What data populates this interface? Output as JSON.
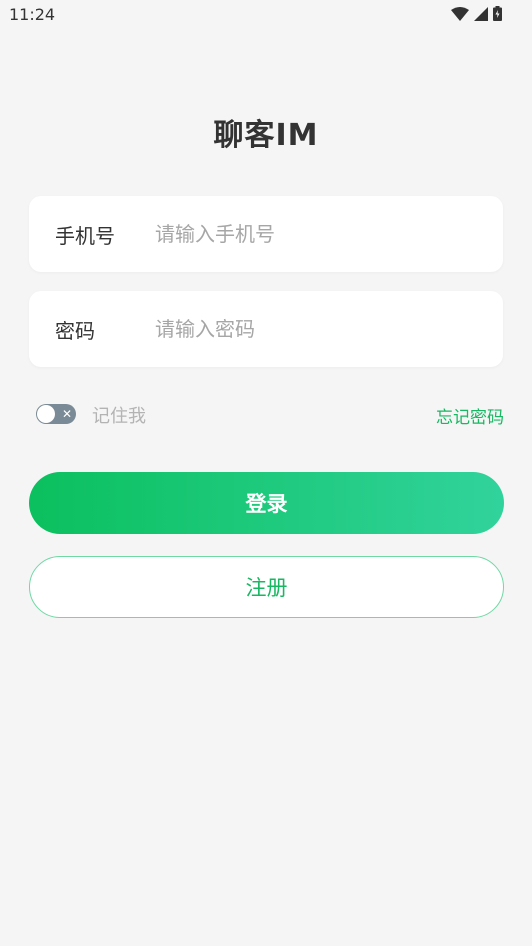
{
  "status_bar": {
    "time": "11:24",
    "icons": [
      "wifi-icon",
      "cellular-signal-icon",
      "battery-charging-icon"
    ]
  },
  "app": {
    "title": "聊客IM"
  },
  "form": {
    "phone": {
      "label": "手机号",
      "value": "",
      "placeholder": "请输入手机号"
    },
    "password": {
      "label": "密码",
      "value": "",
      "placeholder": "请输入密码"
    },
    "remember": {
      "label": "记住我",
      "enabled": false
    },
    "forgot_password_label": "忘记密码"
  },
  "actions": {
    "login_label": "登录",
    "register_label": "注册"
  },
  "colors": {
    "accent": "#17b862",
    "gradient_start": "#0bc05e",
    "gradient_end": "#31d39c",
    "background": "#f5f5f5",
    "toggle_off": "#7a8a96"
  }
}
